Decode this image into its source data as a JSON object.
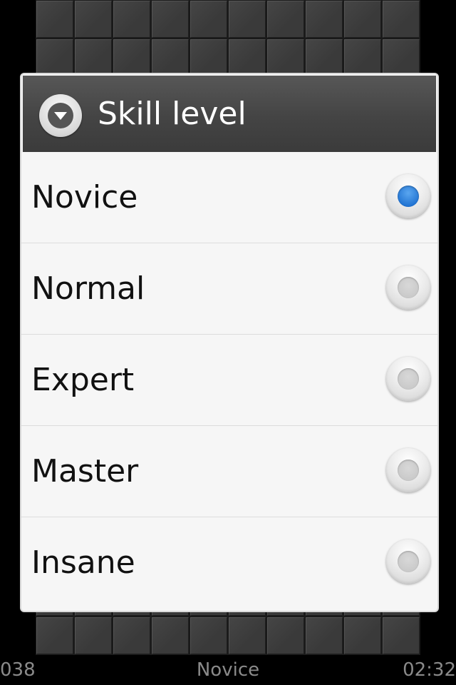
{
  "dialog": {
    "title": "Skill level",
    "header_icon": "chevron-down-circle-icon",
    "options": [
      {
        "label": "Novice",
        "selected": true
      },
      {
        "label": "Normal",
        "selected": false
      },
      {
        "label": "Expert",
        "selected": false
      },
      {
        "label": "Master",
        "selected": false
      },
      {
        "label": "Insane",
        "selected": false
      }
    ]
  },
  "status_bar": {
    "left": "038",
    "center": "Novice",
    "right": "02:32"
  },
  "colors": {
    "accent": "#1c6fd0",
    "header_bg": "#444444",
    "dialog_bg": "#f6f6f6"
  }
}
